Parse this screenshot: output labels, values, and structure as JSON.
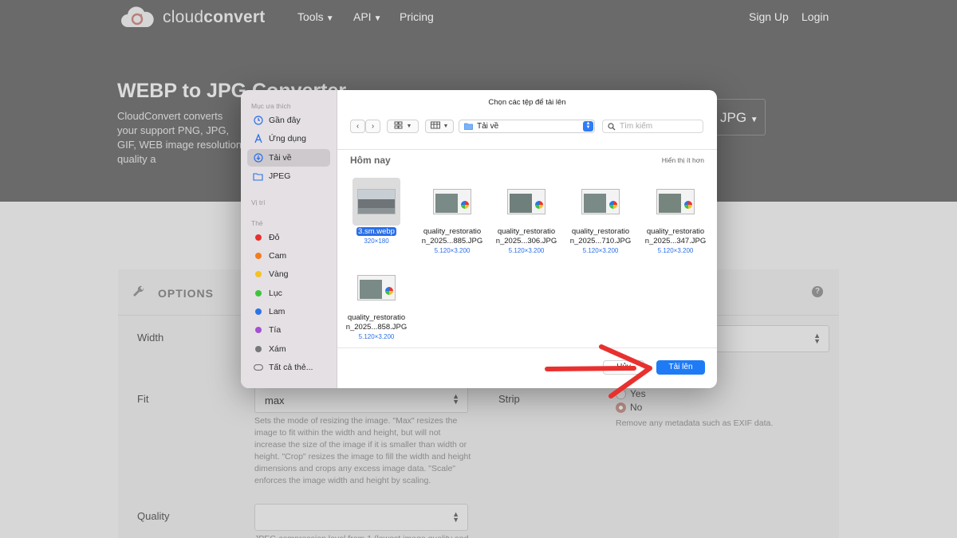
{
  "nav": {
    "logo_prefix": "cloud",
    "logo_suffix": "convert",
    "tools": "Tools",
    "api": "API",
    "pricing": "Pricing",
    "sign_up": "Sign Up",
    "login": "Login"
  },
  "hero": {
    "title": "WEBP to JPG Converter",
    "description": "CloudConvert converts your support PNG, JPG, GIF, WEB image resolution, quality a",
    "format_select": "JPG"
  },
  "options": {
    "title": "OPTIONS",
    "width_label": "Width",
    "fit_label": "Fit",
    "fit_value": "max",
    "fit_help": "Sets the mode of resizing the image. \"Max\" resizes the image to fit within the width and height, but will not increase the size of the image if it is smaller than width or height. \"Crop\" resizes the image to fill the width and height dimensions and crops any excess image data. \"Scale\" enforces the image width and height by scaling.",
    "strip_label": "Strip",
    "strip_yes": "Yes",
    "strip_no": "No",
    "strip_help": "Remove any metadata such as EXIF data.",
    "quality_label": "Quality",
    "quality_help": "JPEG compression level from 1 (lowest image quality and"
  },
  "dialog": {
    "title": "Chọn các tệp để tải lên",
    "sidebar": {
      "favorites_heading": "Mục ưa thích",
      "favorites": [
        {
          "label": "Gần đây",
          "icon": "clock-icon"
        },
        {
          "label": "Ứng dụng",
          "icon": "applications-icon"
        },
        {
          "label": "Tải về",
          "icon": "downloads-icon",
          "selected": true
        },
        {
          "label": "JPEG",
          "icon": "folder-icon"
        }
      ],
      "locations_heading": "Vị trí",
      "tags_heading": "Thẻ",
      "tags": [
        {
          "label": "Đỏ",
          "color": "#e8302f"
        },
        {
          "label": "Cam",
          "color": "#f27d21"
        },
        {
          "label": "Vàng",
          "color": "#f3c226"
        },
        {
          "label": "Lục",
          "color": "#3ec43c"
        },
        {
          "label": "Lam",
          "color": "#2a74e8"
        },
        {
          "label": "Tía",
          "color": "#a54fd3"
        },
        {
          "label": "Xám",
          "color": "#77777b"
        }
      ],
      "all_tags": "Tất cả thẻ..."
    },
    "location": "Tải về",
    "search_placeholder": "Tìm kiếm",
    "group_label": "Hôm nay",
    "show_less": "Hiển thị ít hơn",
    "files": [
      {
        "name_line1": "3.sm.webp",
        "name_line2": "",
        "dims": "320×180",
        "selected": true
      },
      {
        "name_line1": "quality_restoratio",
        "name_line2": "n_2025...885.JPG",
        "dims": "5.120×3.200"
      },
      {
        "name_line1": "quality_restoratio",
        "name_line2": "n_2025...306.JPG",
        "dims": "5.120×3.200"
      },
      {
        "name_line1": "quality_restoratio",
        "name_line2": "n_2025...710.JPG",
        "dims": "5.120×3.200"
      },
      {
        "name_line1": "quality_restoratio",
        "name_line2": "n_2025...347.JPG",
        "dims": "5.120×3.200"
      },
      {
        "name_line1": "quality_restoratio",
        "name_line2": "n_2025...858.JPG",
        "dims": "5.120×3.200"
      }
    ],
    "cancel_label": "Hủy",
    "upload_label": "Tải lên"
  },
  "colors": {
    "accent_blue": "#1f7bf5",
    "annotation_arrow": "#e8312f"
  }
}
